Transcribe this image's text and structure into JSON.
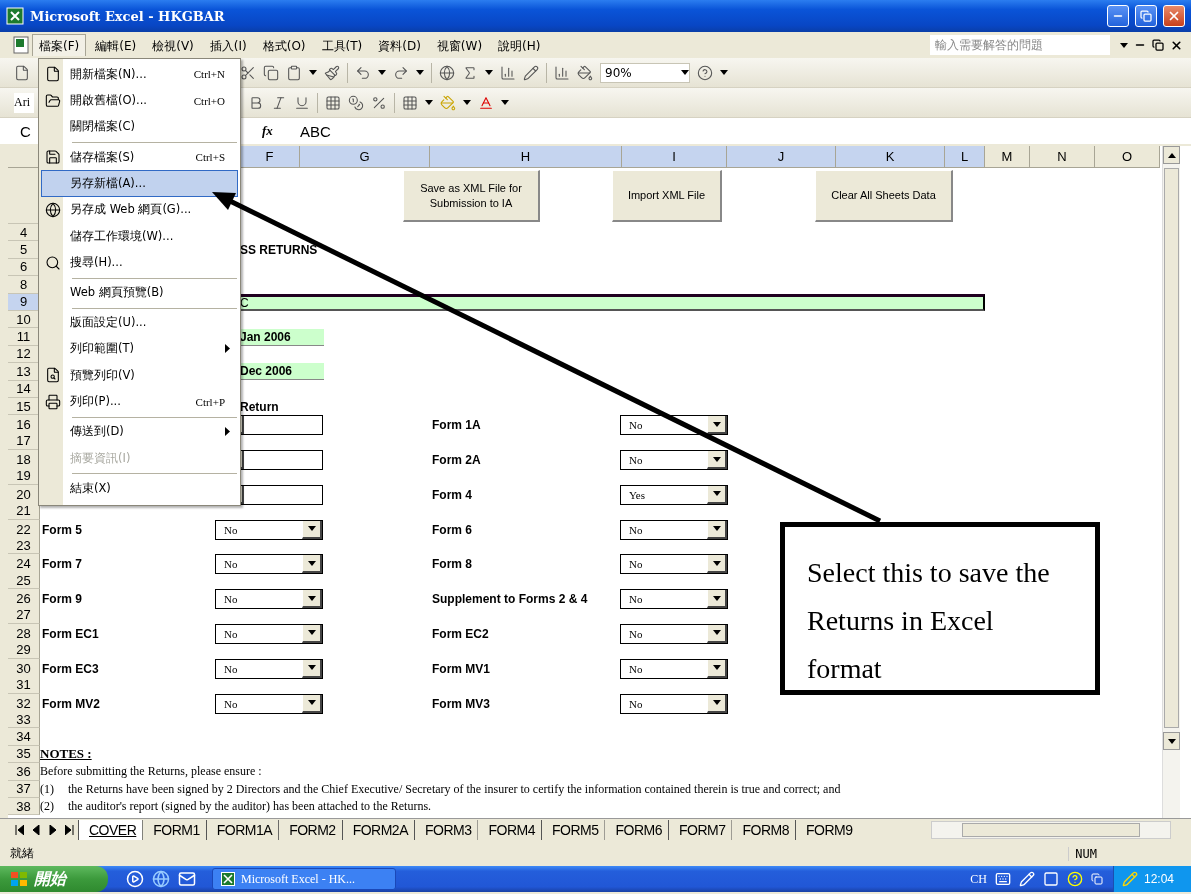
{
  "window": {
    "title": "Microsoft Excel - HKGBAR"
  },
  "menu_bar": {
    "items": [
      {
        "label": "檔案(F)",
        "selected": true
      },
      {
        "label": "編輯(E)",
        "selected": false
      },
      {
        "label": "檢視(V)",
        "selected": false
      },
      {
        "label": "插入(I)",
        "selected": false
      },
      {
        "label": "格式(O)",
        "selected": false
      },
      {
        "label": "工具(T)",
        "selected": false
      },
      {
        "label": "資料(D)",
        "selected": false
      },
      {
        "label": "視窗(W)",
        "selected": false
      },
      {
        "label": "說明(H)",
        "selected": false
      }
    ],
    "help_box": {
      "placeholder": "輸入需要解答的問題"
    }
  },
  "toolbar": {
    "zoom": "90%",
    "font": "Ari"
  },
  "formula_bar": {
    "name_box": "C",
    "function_label": "fx",
    "value": "ABC"
  },
  "columns": [
    {
      "label": "F",
      "selected": true
    },
    {
      "label": "G",
      "selected": true
    },
    {
      "label": "H",
      "selected": true
    },
    {
      "label": "I",
      "selected": true
    },
    {
      "label": "J",
      "selected": true
    },
    {
      "label": "K",
      "selected": true
    },
    {
      "label": "L",
      "selected": true
    },
    {
      "label": "M",
      "selected": false
    },
    {
      "label": "N",
      "selected": false
    },
    {
      "label": "O",
      "selected": false
    }
  ],
  "sheet": {
    "buttons": [
      "Save as XML File for Submission to IA",
      "Import XML File",
      "Clear All Sheets Data"
    ],
    "rows": [
      {
        "number": "4",
        "selected": false,
        "kind": "blank"
      },
      {
        "number": "5",
        "selected": false,
        "kind": "title",
        "text": "SS RETURNS"
      },
      {
        "number": "6",
        "selected": false,
        "kind": "blank"
      },
      {
        "number": "8",
        "selected": false,
        "kind": "blank"
      },
      {
        "number": "9",
        "selected": true,
        "kind": "band",
        "text": "C"
      },
      {
        "number": "10",
        "selected": false,
        "kind": "blank"
      },
      {
        "number": "11",
        "selected": false,
        "kind": "date",
        "text": "Jan 2006"
      },
      {
        "number": "12",
        "selected": false,
        "kind": "blank"
      },
      {
        "number": "13",
        "selected": false,
        "kind": "date",
        "text": "Dec 2006"
      },
      {
        "number": "14",
        "selected": false,
        "kind": "blank"
      },
      {
        "number": "15",
        "selected": false,
        "kind": "heading",
        "text": "Return"
      },
      {
        "number": "16",
        "selected": false,
        "kind": "forms",
        "left": {},
        "right": {
          "label": "Form 1A",
          "value": "No"
        }
      },
      {
        "number": "17",
        "selected": false,
        "kind": "blank"
      },
      {
        "number": "18",
        "selected": false,
        "kind": "forms",
        "left": {},
        "right": {
          "label": "Form 2A",
          "value": "No"
        }
      },
      {
        "number": "19",
        "selected": false,
        "kind": "blank"
      },
      {
        "number": "20",
        "selected": false,
        "kind": "forms",
        "left": {},
        "right": {
          "label": "Form 4",
          "value": "Yes"
        }
      },
      {
        "number": "21",
        "selected": false,
        "kind": "blank"
      },
      {
        "number": "22",
        "selected": false,
        "kind": "forms",
        "left": {
          "label": "Form 5",
          "value": "No"
        },
        "right": {
          "label": "Form 6",
          "value": "No"
        }
      },
      {
        "number": "23",
        "selected": false,
        "kind": "blank"
      },
      {
        "number": "24",
        "selected": false,
        "kind": "forms",
        "left": {
          "label": "Form 7",
          "value": "No"
        },
        "right": {
          "label": "Form 8",
          "value": "No"
        }
      },
      {
        "number": "25",
        "selected": false,
        "kind": "blank"
      },
      {
        "number": "26",
        "selected": false,
        "kind": "forms",
        "left": {
          "label": "Form 9",
          "value": "No"
        },
        "right": {
          "label": "Supplement to Forms 2 & 4",
          "value": "No"
        }
      },
      {
        "number": "27",
        "selected": false,
        "kind": "blank"
      },
      {
        "number": "28",
        "selected": false,
        "kind": "forms",
        "left": {
          "label": "Form EC1",
          "value": "No"
        },
        "right": {
          "label": "Form EC2",
          "value": "No"
        }
      },
      {
        "number": "29",
        "selected": false,
        "kind": "blank"
      },
      {
        "number": "30",
        "selected": false,
        "kind": "forms",
        "left": {
          "label": "Form EC3",
          "value": "No"
        },
        "right": {
          "label": "Form MV1",
          "value": "No"
        }
      },
      {
        "number": "31",
        "selected": false,
        "kind": "blank"
      },
      {
        "number": "32",
        "selected": false,
        "kind": "forms",
        "left": {
          "label": "Form MV2",
          "value": "No"
        },
        "right": {
          "label": "Form MV3",
          "value": "No"
        }
      },
      {
        "number": "33",
        "selected": false,
        "kind": "blank"
      },
      {
        "number": "34",
        "selected": false,
        "kind": "blank"
      },
      {
        "number": "35",
        "selected": false,
        "kind": "notes_heading",
        "text": "NOTES :"
      },
      {
        "number": "36",
        "selected": false,
        "kind": "note",
        "text": "Before submitting the Returns, please ensure :"
      },
      {
        "number": "37",
        "selected": false,
        "kind": "item",
        "marker": "(1)",
        "text": "the Returns have been signed by 2 Directors and the Chief Executive/ Secretary of the insurer to certify the information contained therein is true and correct; and"
      },
      {
        "number": "38",
        "selected": false,
        "kind": "item",
        "marker": "(2)",
        "text": "the auditor's report (signed by the auditor) has been attached to the Returns."
      }
    ]
  },
  "file_menu": {
    "items": [
      {
        "label": "開新檔案(N)...",
        "shortcut": "Ctrl+N",
        "selected": false,
        "disabled": false,
        "separator_before": false,
        "submenu": false
      },
      {
        "label": "開啟舊檔(O)...",
        "shortcut": "Ctrl+O",
        "selected": false,
        "disabled": false,
        "separator_before": false,
        "submenu": false
      },
      {
        "label": "關閉檔案(C)",
        "selected": false,
        "disabled": false,
        "separator_before": false,
        "submenu": false
      },
      {
        "label": "儲存檔案(S)",
        "shortcut": "Ctrl+S",
        "selected": false,
        "disabled": false,
        "separator_before": true,
        "submenu": false
      },
      {
        "label": "另存新檔(A)...",
        "selected": true,
        "disabled": false,
        "separator_before": false,
        "submenu": false
      },
      {
        "label": "另存成 Web 網頁(G)...",
        "selected": false,
        "disabled": false,
        "separator_before": false,
        "submenu": false
      },
      {
        "label": "儲存工作環境(W)...",
        "selected": false,
        "disabled": false,
        "separator_before": false,
        "submenu": false
      },
      {
        "label": "搜尋(H)...",
        "selected": false,
        "disabled": false,
        "separator_before": false,
        "submenu": false
      },
      {
        "label": "Web 網頁預覽(B)",
        "selected": false,
        "disabled": false,
        "separator_before": true,
        "submenu": false
      },
      {
        "label": "版面設定(U)...",
        "selected": false,
        "disabled": false,
        "separator_before": true,
        "submenu": false
      },
      {
        "label": "列印範圍(T)",
        "selected": false,
        "disabled": false,
        "separator_before": false,
        "submenu": true
      },
      {
        "label": "預覽列印(V)",
        "selected": false,
        "disabled": false,
        "separator_before": false,
        "submenu": false
      },
      {
        "label": "列印(P)...",
        "shortcut": "Ctrl+P",
        "selected": false,
        "disabled": false,
        "separator_before": false,
        "submenu": false
      },
      {
        "label": "傳送到(D)",
        "selected": false,
        "disabled": false,
        "separator_before": true,
        "submenu": true
      },
      {
        "label": "摘要資訊(I)",
        "selected": false,
        "disabled": true,
        "separator_before": false,
        "submenu": false
      },
      {
        "label": "結束(X)",
        "selected": false,
        "disabled": false,
        "separator_before": true,
        "submenu": false
      }
    ]
  },
  "callout": {
    "text": "Select this to save the Returns in Excel format"
  },
  "sheet_tabs": [
    {
      "label": "COVER",
      "selected": true
    },
    {
      "label": "FORM1",
      "selected": false
    },
    {
      "label": "FORM1A",
      "selected": false
    },
    {
      "label": "FORM2",
      "selected": false
    },
    {
      "label": "FORM2A",
      "selected": false
    },
    {
      "label": "FORM3",
      "selected": false
    },
    {
      "label": "FORM4",
      "selected": false
    },
    {
      "label": "FORM5",
      "selected": false
    },
    {
      "label": "FORM6",
      "selected": false
    },
    {
      "label": "FORM7",
      "selected": false
    },
    {
      "label": "FORM8",
      "selected": false
    },
    {
      "label": "FORM9",
      "selected": false
    }
  ],
  "status_bar": {
    "text": "就緒",
    "indicator": "NUM"
  },
  "taskbar": {
    "start": "開始",
    "task": "Microsoft Excel - HK...",
    "language": "CH",
    "clock": "12:04"
  }
}
